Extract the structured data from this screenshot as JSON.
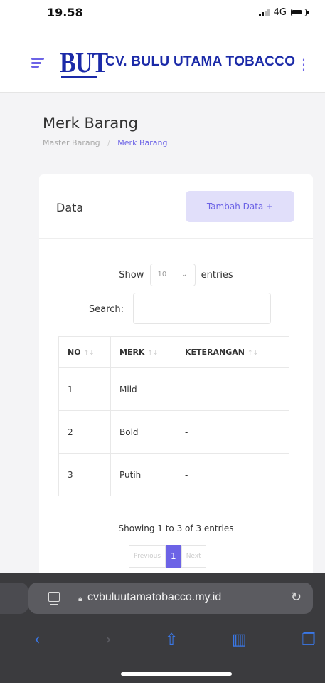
{
  "status_bar": {
    "time": "19.58",
    "network": "4G"
  },
  "header": {
    "logo_text": "BUT",
    "company_name": "CV. BULU UTAMA TOBACCO"
  },
  "page": {
    "title": "Merk Barang",
    "breadcrumb": [
      "Master Barang",
      "/",
      "Merk Barang"
    ]
  },
  "card": {
    "title": "Data",
    "add_button": "Tambah Data +"
  },
  "table_controls": {
    "show_label": "Show",
    "entries_value": "10",
    "entries_label": "entries",
    "search_label": "Search:",
    "search_value": ""
  },
  "table": {
    "columns": [
      "NO",
      "MERK",
      "KETERANGAN"
    ],
    "rows": [
      [
        "1",
        "Mild",
        "-"
      ],
      [
        "2",
        "Bold",
        "-"
      ],
      [
        "3",
        "Putih",
        "-"
      ]
    ]
  },
  "footer": {
    "info": "Showing 1 to 3 of 3 entries",
    "pagination": {
      "previous": "Previous",
      "current": "1",
      "next": "Next"
    }
  },
  "browser": {
    "url": "cvbuluutamatobacco.my.id"
  },
  "colors": {
    "accent": "#6c63e6",
    "brand": "#1b2aa8",
    "browser_bg": "#3b3b3e",
    "link": "#3a78e8"
  }
}
